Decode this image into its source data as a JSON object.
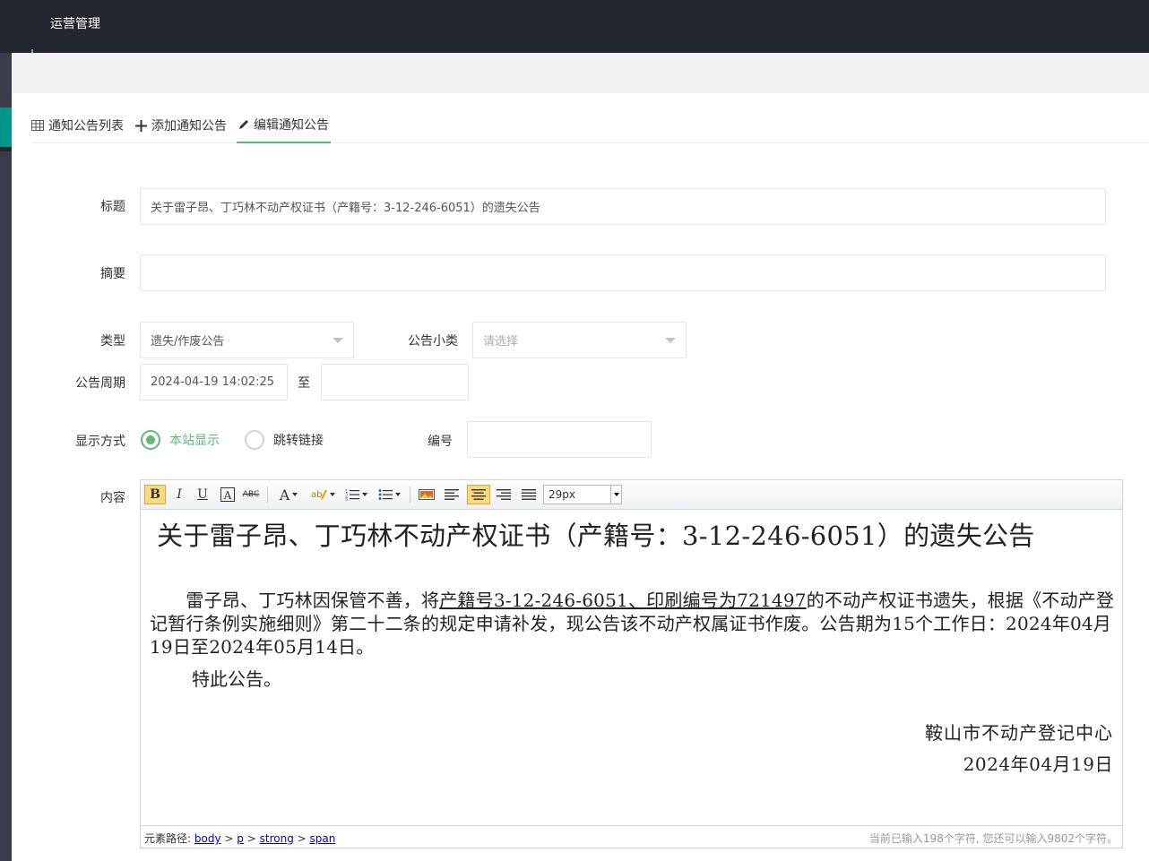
{
  "header": {
    "menu": "运营管理"
  },
  "tabs": [
    {
      "label": "通知公告列表",
      "icon": "table-icon"
    },
    {
      "label": "添加通知公告",
      "icon": "plus-icon"
    },
    {
      "label": "编辑通知公告",
      "icon": "pencil-icon",
      "active": true
    }
  ],
  "form": {
    "title_label": "标题",
    "title_value": "关于雷子昂、丁巧林不动产权证书（产籍号：3-12-246-6051）的遗失公告",
    "summary_label": "摘要",
    "summary_value": "",
    "type_label": "类型",
    "type_value": "遗失/作废公告",
    "subtype_label": "公告小类",
    "subtype_placeholder": "请选择",
    "period_label": "公告周期",
    "period_start": "2024-04-19 14:02:25",
    "period_sep": "至",
    "period_end": "",
    "display_label": "显示方式",
    "display_options": [
      "本站显示",
      "跳转链接"
    ],
    "display_selected": "本站显示",
    "number_label": "编号",
    "number_value": "",
    "content_label": "内容"
  },
  "editor": {
    "font_size": "29px",
    "toolbar_icons": [
      "bold-icon",
      "italic-icon",
      "underline-icon",
      "font-border-icon",
      "strikethrough-icon",
      "font-color-icon",
      "highlight-icon",
      "ordered-list-icon",
      "unordered-list-icon",
      "image-icon",
      "align-left-icon",
      "align-center-icon",
      "align-right-icon",
      "align-justify-icon"
    ],
    "content": {
      "title": "关于雷子昂、丁巧林不动产权证书（产籍号：3-12-246-6051）的遗失公告",
      "para_indent": "　　",
      "para_part1": "雷子昂、丁巧林因保管不善，将",
      "para_underlined": "产籍号3-12-246-6051、印刷编号为721497",
      "para_part2": "的不动产权证书遗失，根据《不动产登记暂行条例实施细则》第二十二条的规定申请补发，现公告该不动产权属证书作废。公告期为15个工作日：2024年04月19日至2024年05月14日。",
      "closing": "特此公告。",
      "organization": "鞍山市不动产登记中心",
      "date": "2024年04月19日"
    },
    "status": {
      "path_label": "元素路径:",
      "path": [
        "body",
        "p",
        "strong",
        "span"
      ],
      "path_sep": ">",
      "count_text": "当前已输入198个字符, 您还可以输入9802个字符。"
    }
  },
  "colors": {
    "accent": "#5fb878",
    "topbar": "#23262e",
    "sidebar": "#393d49",
    "sidebar_active": "#009688"
  }
}
